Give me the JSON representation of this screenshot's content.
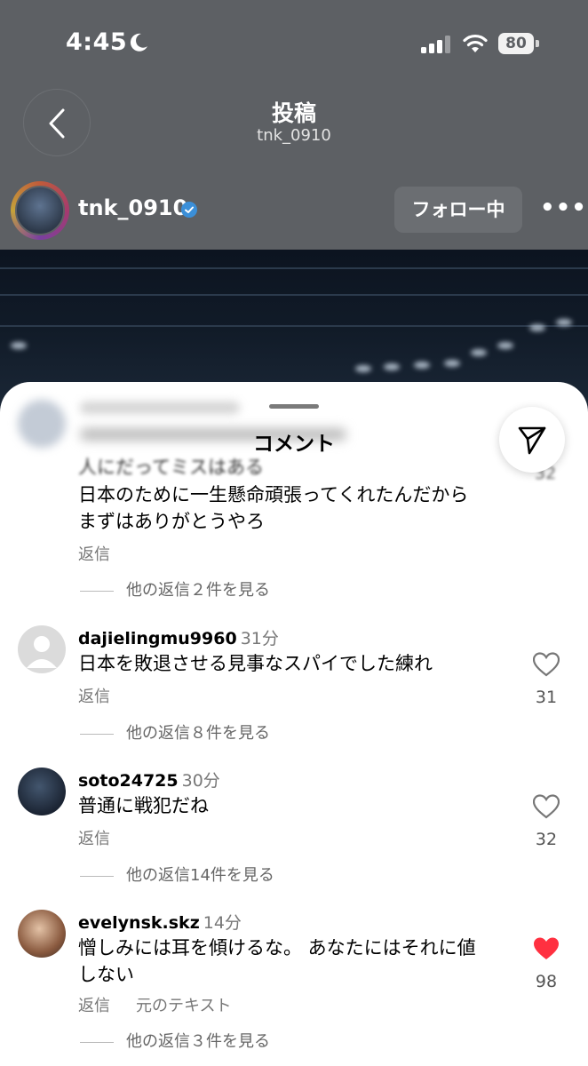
{
  "status_bar": {
    "time": "4:45",
    "battery": "80"
  },
  "header": {
    "title": "投稿",
    "subtitle": "tnk_0910"
  },
  "author": {
    "username": "tnk_0910",
    "follow_label": "フォロー中",
    "more": "•••"
  },
  "sheet": {
    "title": "コメント"
  },
  "comments": [
    {
      "partial_text": "人にだってミスはある",
      "partial_count": "32",
      "text_line1": "日本のために一生懸命頑張ってくれたんだから",
      "text_line2": "まずはありがとうやろ",
      "reply_label": "返信",
      "more_replies": "他の返信２件を見る"
    },
    {
      "username": "dajielingmu9960",
      "time": "31分",
      "text": "日本を敗退させる見事なスパイでした練れ",
      "reply_label": "返信",
      "more_replies": "他の返信８件を見る",
      "likes": "31",
      "liked": false
    },
    {
      "username": "soto24725",
      "time": "30分",
      "text": "普通に戦犯だね",
      "reply_label": "返信",
      "more_replies": "他の返信14件を見る",
      "likes": "32",
      "liked": false
    },
    {
      "username": "evelynsk.skz",
      "time": "14分",
      "text_line1": "憎しみには耳を傾けるな。 あなたにはそれに値",
      "text_line2": "しない",
      "reply_label": "返信",
      "original_text_label": "元のテキスト",
      "more_replies": "他の返信３件を見る",
      "likes": "98",
      "liked": true
    }
  ],
  "colors": {
    "like_red": "#ff3040",
    "verified_blue": "#0095f6"
  }
}
